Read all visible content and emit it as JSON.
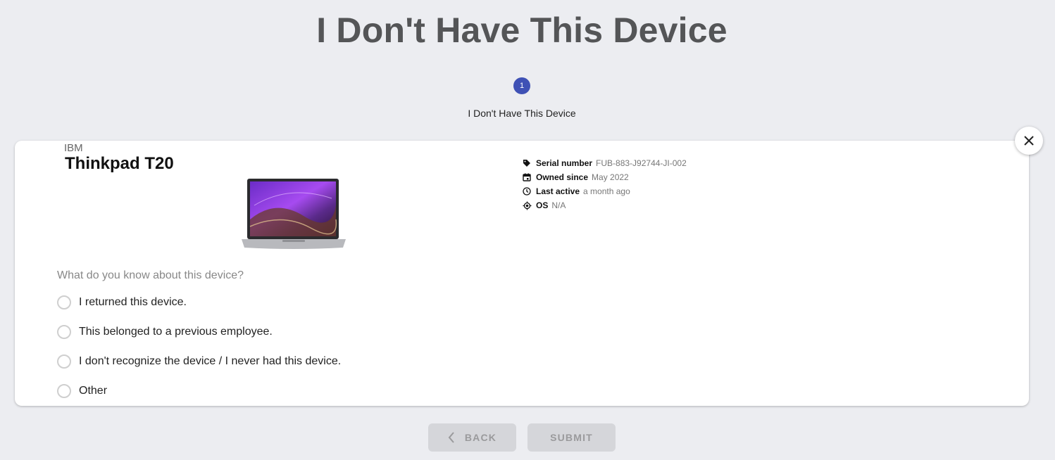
{
  "header": {
    "title": "I Don't Have This Device"
  },
  "stepper": {
    "steps": [
      {
        "number": "1",
        "label": "I Don't Have This Device",
        "color": "#3f51b5"
      }
    ]
  },
  "device": {
    "brand": "IBM",
    "model": "Thinkpad T20",
    "specs": [
      {
        "icon": "tag-icon",
        "key": "Serial number",
        "value": "FUB-883-J92744-JI-002"
      },
      {
        "icon": "calendar-icon",
        "key": "Owned since",
        "value": "May 2022"
      },
      {
        "icon": "clock-icon",
        "key": "Last active",
        "value": "a month ago"
      },
      {
        "icon": "gps-icon",
        "key": "OS",
        "value": "N/A"
      }
    ]
  },
  "form": {
    "question": "What do you know about this device?",
    "options": [
      "I returned this device.",
      "This belonged to a previous employee.",
      "I don't recognize the device / I never had this device.",
      "Other"
    ]
  },
  "footer": {
    "back_label": "BACK",
    "submit_label": "SUBMIT"
  }
}
